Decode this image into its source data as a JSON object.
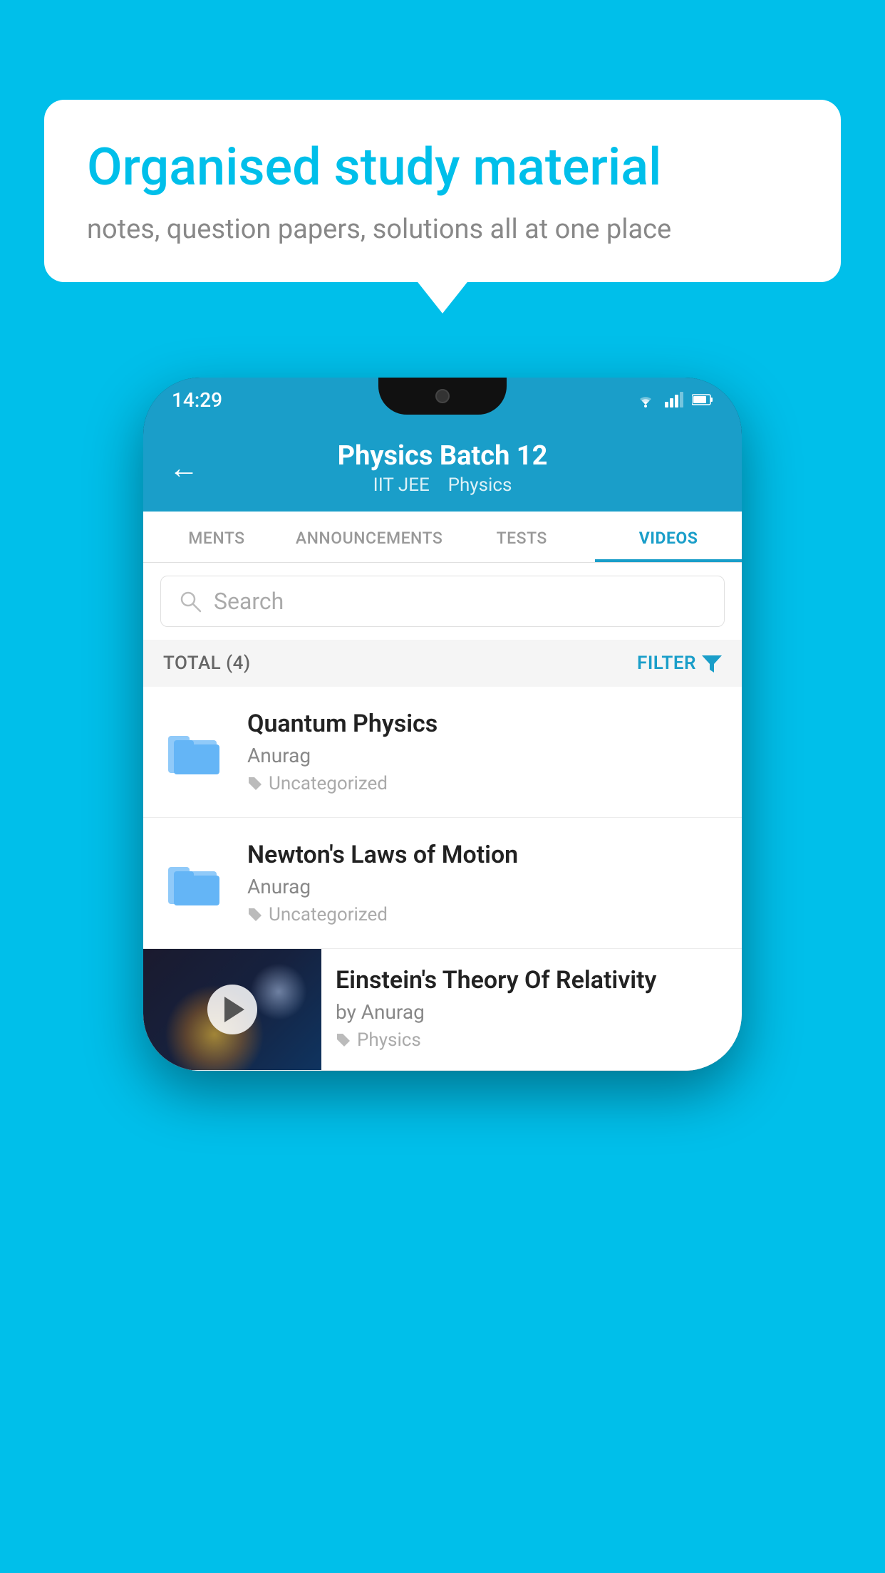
{
  "background": {
    "color": "#00BFEA"
  },
  "speech_bubble": {
    "title": "Organised study material",
    "subtitle": "notes, question papers, solutions all at one place"
  },
  "phone": {
    "status_bar": {
      "time": "14:29",
      "icons": [
        "wifi",
        "signal",
        "battery"
      ]
    },
    "header": {
      "back_label": "←",
      "title": "Physics Batch 12",
      "subtitle_parts": [
        "IIT JEE",
        "Physics"
      ]
    },
    "tabs": [
      {
        "label": "MENTS",
        "active": false
      },
      {
        "label": "ANNOUNCEMENTS",
        "active": false
      },
      {
        "label": "TESTS",
        "active": false
      },
      {
        "label": "VIDEOS",
        "active": true
      }
    ],
    "search": {
      "placeholder": "Search"
    },
    "filter_row": {
      "total_label": "TOTAL (4)",
      "filter_label": "FILTER"
    },
    "videos": [
      {
        "id": "quantum-physics",
        "title": "Quantum Physics",
        "author": "Anurag",
        "tag": "Uncategorized",
        "has_thumbnail": false
      },
      {
        "id": "newtons-laws",
        "title": "Newton's Laws of Motion",
        "author": "Anurag",
        "tag": "Uncategorized",
        "has_thumbnail": false
      },
      {
        "id": "einsteins-theory",
        "title": "Einstein's Theory Of Relativity",
        "author": "by Anurag",
        "tag": "Physics",
        "has_thumbnail": true
      }
    ]
  }
}
